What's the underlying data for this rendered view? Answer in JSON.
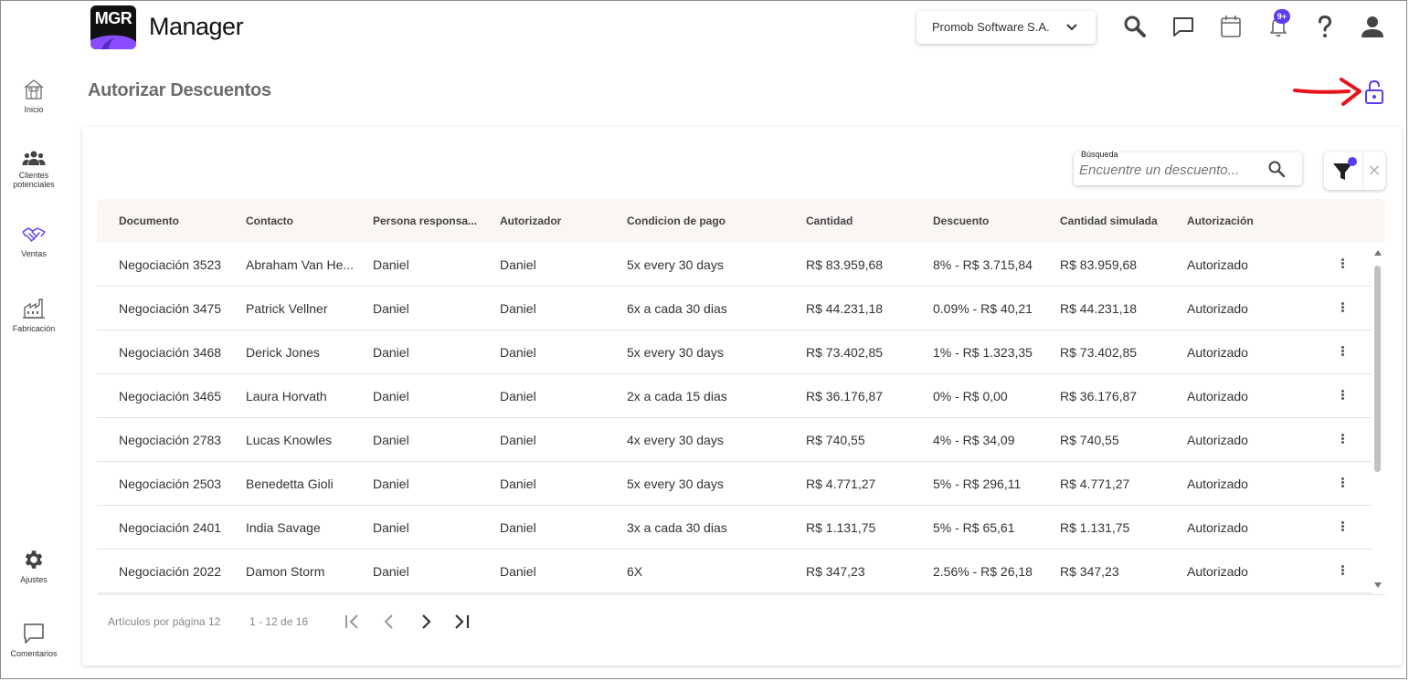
{
  "header": {
    "logo_text": "MGR",
    "app_title": "Manager",
    "company": "Promob Software S.A.",
    "notification_badge": "9+"
  },
  "sidebar": {
    "items": [
      {
        "label": "Inicio",
        "icon": "home-icon"
      },
      {
        "label": "Clientes potenciales",
        "icon": "people-icon"
      },
      {
        "label": "Ventas",
        "icon": "handshake-icon"
      },
      {
        "label": "Fabricación",
        "icon": "factory-icon"
      },
      {
        "label": "Ajustes",
        "icon": "gear-icon"
      },
      {
        "label": "Comentarios",
        "icon": "comment-icon"
      }
    ]
  },
  "page": {
    "title": "Autorizar Descuentos"
  },
  "search": {
    "label": "Búsqueda",
    "placeholder": "Encuentre un descuento..."
  },
  "colors": {
    "accent": "#5b3cf5",
    "annotation": "#e8121b",
    "header_bg": "#f9f6f4"
  },
  "table": {
    "columns": [
      "Documento",
      "Contacto",
      "Persona responsa...",
      "Autorizador",
      "Condicion de pago",
      "Cantidad",
      "Descuento",
      "Cantidad simulada",
      "Autorización"
    ],
    "rows": [
      [
        "Negociación 3523",
        "Abraham Van He...",
        "Daniel",
        "Daniel",
        "5x every 30 days",
        "R$ 83.959,68",
        "8% - R$ 3.715,84",
        "R$ 83.959,68",
        "Autorizado"
      ],
      [
        "Negociación 3475",
        "Patrick Vellner",
        "Daniel",
        "Daniel",
        "6x a cada 30 dias",
        "R$ 44.231,18",
        "0.09% - R$ 40,21",
        "R$ 44.231,18",
        "Autorizado"
      ],
      [
        "Negociación 3468",
        "Derick Jones",
        "Daniel",
        "Daniel",
        "5x every 30 days",
        "R$ 73.402,85",
        "1% - R$ 1.323,35",
        "R$ 73.402,85",
        "Autorizado"
      ],
      [
        "Negociación 3465",
        "Laura Horvath",
        "Daniel",
        "Daniel",
        "2x a cada 15 dias",
        "R$ 36.176,87",
        "0% - R$ 0,00",
        "R$ 36.176,87",
        "Autorizado"
      ],
      [
        "Negociación 2783",
        "Lucas Knowles",
        "Daniel",
        "Daniel",
        "4x every 30 days",
        "R$ 740,55",
        "4% - R$ 34,09",
        "R$ 740,55",
        "Autorizado"
      ],
      [
        "Negociación 2503",
        "Benedetta Gioli",
        "Daniel",
        "Daniel",
        "5x every 30 days",
        "R$ 4.771,27",
        "5% - R$ 296,11",
        "R$ 4.771,27",
        "Autorizado"
      ],
      [
        "Negociación 2401",
        "India Savage",
        "Daniel",
        "Daniel",
        "3x a cada 30 dias",
        "R$ 1.131,75",
        "5% - R$ 65,61",
        "R$ 1.131,75",
        "Autorizado"
      ],
      [
        "Negociación 2022",
        "Damon Storm",
        "Daniel",
        "Daniel",
        "6X",
        "R$ 347,23",
        "2.56% - R$ 26,18",
        "R$ 347,23",
        "Autorizado"
      ]
    ]
  },
  "pagination": {
    "per_page_label": "Artículos por página",
    "per_page_value": "12",
    "range": "1 - 12 de 16"
  }
}
